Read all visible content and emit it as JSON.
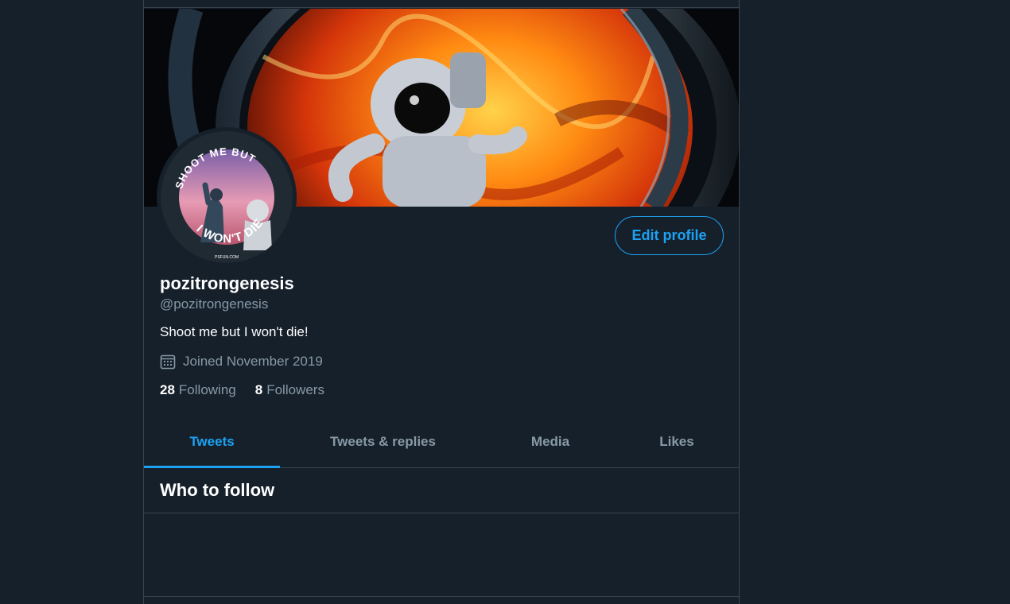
{
  "profile": {
    "display_name": "pozitrongenesis",
    "handle": "@pozitrongenesis",
    "bio": "Shoot me but I won't die!",
    "joined": "Joined November 2019",
    "avatar_text_top": "SHOOT ME BUT",
    "avatar_text_bottom": "I WON'T DIE",
    "avatar_watermark": "PSFUN.COM"
  },
  "actions": {
    "edit_profile": "Edit profile"
  },
  "stats": {
    "following_count": "28",
    "following_label": "Following",
    "followers_count": "8",
    "followers_label": "Followers"
  },
  "tabs": [
    {
      "label": "Tweets",
      "active": true
    },
    {
      "label": "Tweets & replies",
      "active": false
    },
    {
      "label": "Media",
      "active": false
    },
    {
      "label": "Likes",
      "active": false
    }
  ],
  "sections": {
    "who_to_follow": "Who to follow"
  },
  "icons": {
    "joined": "calendar-icon"
  },
  "colors": {
    "background": "#15202b",
    "accent": "#1da1f2",
    "secondary_text": "#8899a6",
    "border": "#38444d"
  }
}
